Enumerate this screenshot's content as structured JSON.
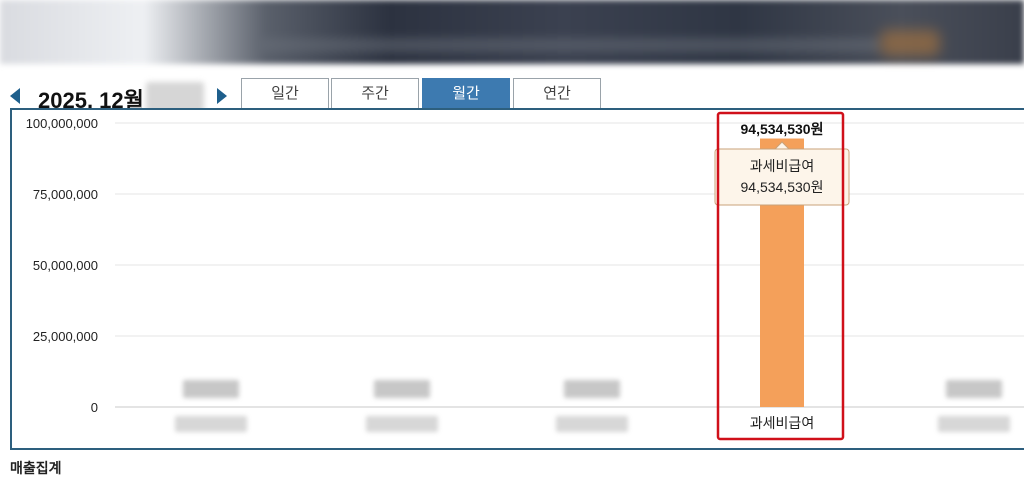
{
  "header": {
    "period": "2025. 12월",
    "prev_icon": "caret-left-icon",
    "next_icon": "caret-right-icon"
  },
  "tabs": [
    {
      "label": "일간",
      "active": false
    },
    {
      "label": "주간",
      "active": false
    },
    {
      "label": "월간",
      "active": true
    },
    {
      "label": "연간",
      "active": false
    }
  ],
  "colors": {
    "accent": "#3d7ab0",
    "bar": "#f4a05a",
    "highlight": "#d0101a",
    "panel_border": "#2d5f7e"
  },
  "chart_data": {
    "type": "bar",
    "categories": [
      "",
      "",
      "",
      "과세비급여",
      ""
    ],
    "values": [
      0,
      0,
      0,
      94534530,
      0
    ],
    "ylim": [
      0,
      100000000
    ],
    "yticks": [
      "0",
      "25,000,000",
      "50,000,000",
      "75,000,000",
      "100,000,000"
    ],
    "ytick_values": [
      0,
      25000000,
      50000000,
      75000000,
      100000000
    ],
    "grid": true,
    "bar_value_label": "94,534,530원",
    "tooltip": {
      "title": "과세비급여",
      "value": "94,534,530원"
    },
    "highlighted_index": 3
  },
  "footer": {
    "title": "매출집계"
  }
}
